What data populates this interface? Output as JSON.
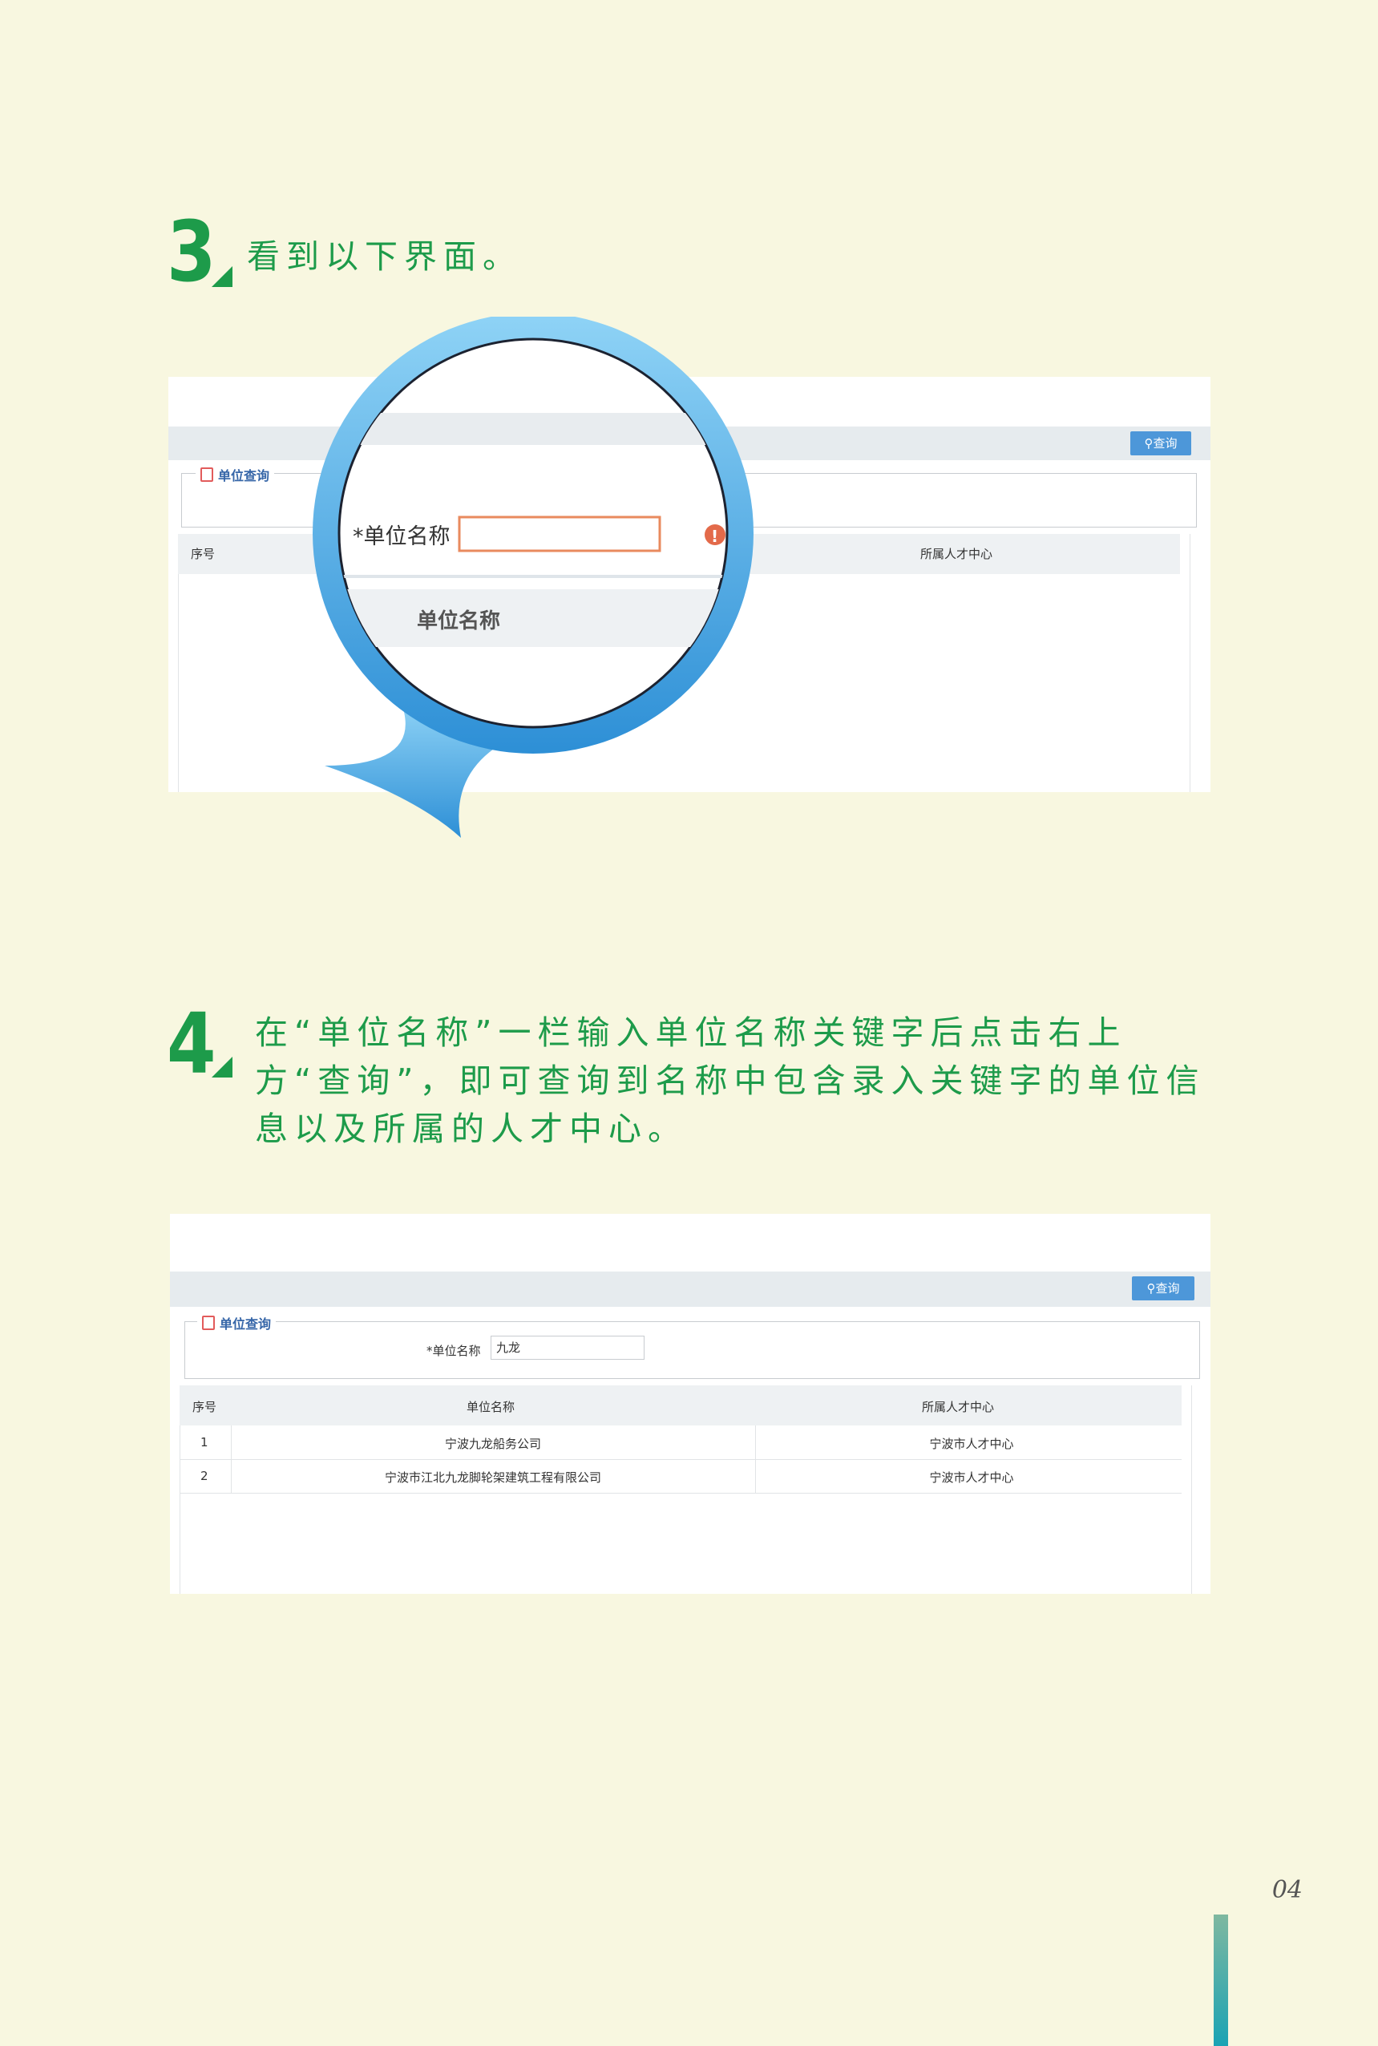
{
  "step3": {
    "number": "3",
    "text": "看到以下界面。"
  },
  "step4": {
    "number": "4",
    "text": "在“单位名称”一栏输入单位名称关键字后点击右上方“查询”，即可查询到名称中包含录入关键字的单位信息以及所属的人才中心。"
  },
  "shot1": {
    "query_button": "查询",
    "legend": "单位查询",
    "columns": [
      "序号",
      "所属人才中心"
    ],
    "magnifier": {
      "field_label": "*单位名称",
      "column_header": "单位名称",
      "error_icon": "!"
    }
  },
  "shot2": {
    "query_button": "查询",
    "legend": "单位查询",
    "field_label": "*单位名称",
    "field_value": "九龙",
    "columns": [
      "序号",
      "单位名称",
      "所属人才中心"
    ],
    "rows": [
      {
        "index": "1",
        "name": "宁波九龙船务公司",
        "center": "宁波市人才中心"
      },
      {
        "index": "2",
        "name": "宁波市江北九龙脚轮架建筑工程有限公司",
        "center": "宁波市人才中心"
      }
    ]
  },
  "page": {
    "number": "04"
  },
  "colors": {
    "accent_green": "#1d9b4a",
    "button_blue": "#4d97d9",
    "magnifier_blue": "#4aa8e6",
    "page_bg": "#f8f7e0"
  }
}
